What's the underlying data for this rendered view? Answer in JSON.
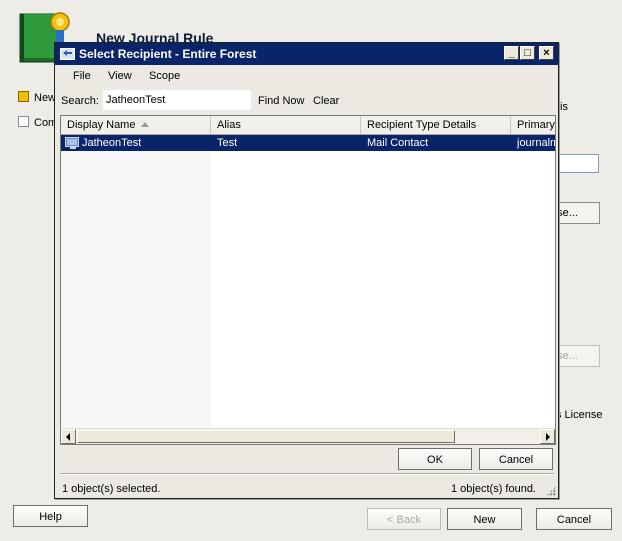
{
  "wizard": {
    "title": "New Journal Rule",
    "steps": [
      {
        "label": "New",
        "active": true
      },
      {
        "label": "Com",
        "active": false
      }
    ],
    "side_text_is": "is",
    "browse_label": "use...",
    "browse_disabled_label": "use...",
    "license_text": "s License",
    "buttons": {
      "help": "Help",
      "back": "< Back",
      "new": "New",
      "cancel": "Cancel"
    }
  },
  "dialog": {
    "title": "Select Recipient - Entire Forest",
    "controls": {
      "minimize": "_",
      "maximize": "□",
      "close": "×"
    },
    "menu": [
      "File",
      "View",
      "Scope"
    ],
    "search": {
      "label": "Search:",
      "value": "JatheonTest",
      "find_now": "Find Now",
      "clear": "Clear"
    },
    "columns": [
      "Display Name",
      "Alias",
      "Recipient Type Details",
      "Primary"
    ],
    "rows": [
      {
        "display_name": "JatheonTest",
        "alias": "Test",
        "recipient_type": "Mail Contact",
        "primary": "journalm",
        "selected": true
      }
    ],
    "ok_label": "OK",
    "cancel_label": "Cancel",
    "status_selected": "1 object(s) selected.",
    "status_found": "1 object(s) found."
  },
  "colors": {
    "selection": "#0a246a",
    "title_bar": "#0a246a",
    "active_step": "#f0c000"
  },
  "icons": {
    "wizard": "journal-book-icon",
    "dialog": "exchange-window-icon",
    "row": "mail-contact-icon",
    "sort": "sort-ascending-icon",
    "resize": "resize-grip-icon"
  }
}
